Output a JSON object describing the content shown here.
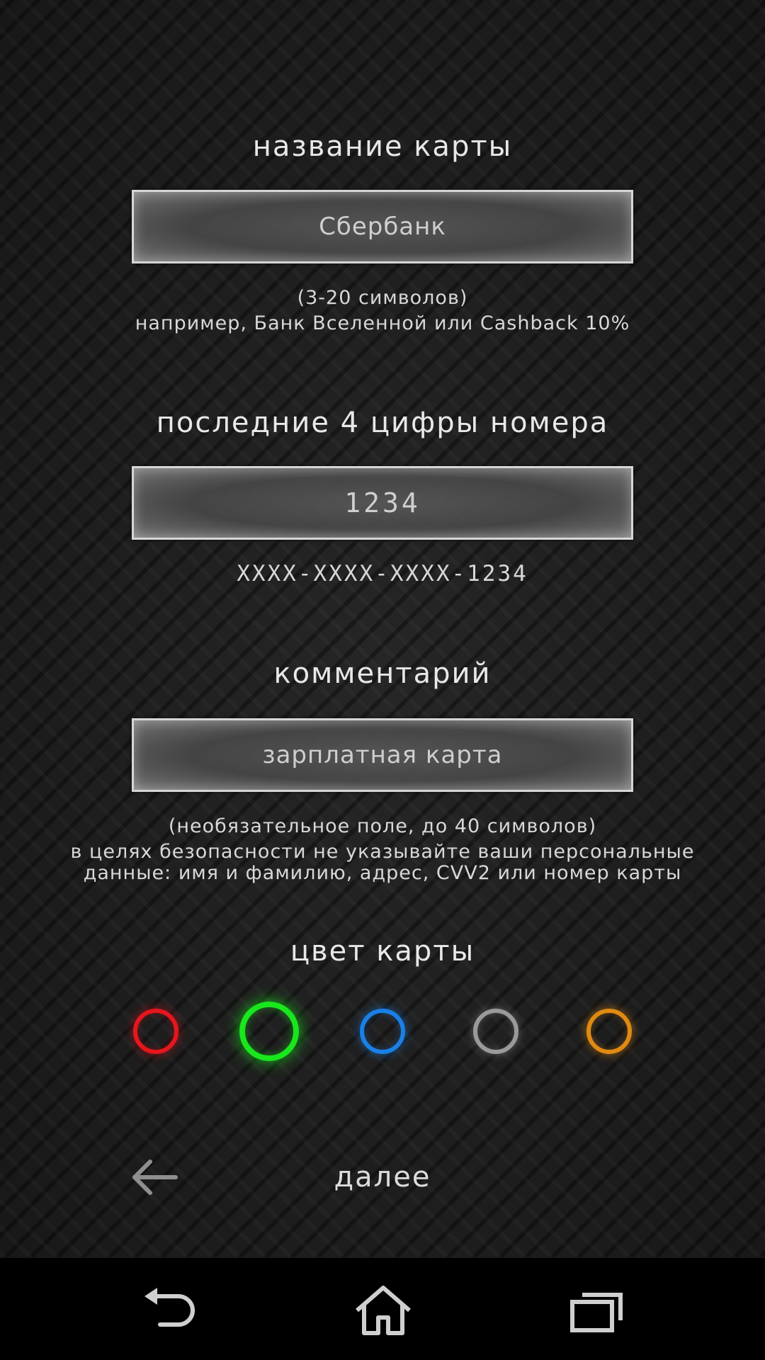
{
  "card_name": {
    "label": "название карты",
    "value": "Сбербанк",
    "hint_line1": "(3-20 символов)",
    "hint_line2": "например, Банк Вселенной или Cashback 10%"
  },
  "last_digits": {
    "label": "последние 4 цифры номера",
    "value": "1234",
    "masked_number": "XXXX-XXXX-XXXX-1234"
  },
  "comment": {
    "label": "комментарий",
    "value": "зарплатная карта",
    "hint_line1": "(необязательное поле, до 40 символов)",
    "hint_line2": "в целях безопасности не указывайте ваши персональные",
    "hint_line3": "данные: имя и фамилию, адрес, CVV2 или номер карты"
  },
  "card_color": {
    "label": "цвет карты",
    "options": [
      {
        "name": "red",
        "color": "#e5161d",
        "selected": false
      },
      {
        "name": "green",
        "color": "#19e61d",
        "selected": true
      },
      {
        "name": "blue",
        "color": "#1a80e6",
        "selected": false
      },
      {
        "name": "gray",
        "color": "#9a9a9a",
        "selected": false
      },
      {
        "name": "orange",
        "color": "#e08a12",
        "selected": false
      }
    ]
  },
  "footer": {
    "back_icon": "arrow-left-icon",
    "next_label": "далее"
  },
  "system_nav": {
    "back_icon": "back-icon",
    "home_icon": "home-icon",
    "recents_icon": "recents-icon"
  }
}
